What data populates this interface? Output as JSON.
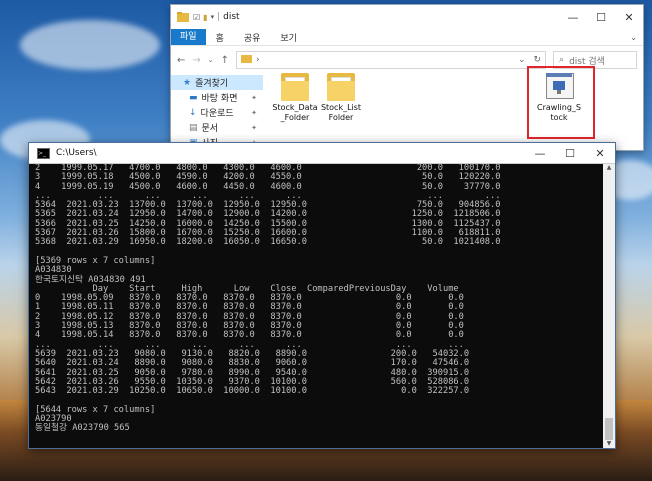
{
  "explorer": {
    "title": "dist",
    "ribbon": {
      "file": "파일",
      "tabs": [
        "홈",
        "공유",
        "보기"
      ]
    },
    "address": "›",
    "search_placeholder": "dist 검색",
    "nav": [
      {
        "label": "즐겨찾기",
        "icon": "star-icon",
        "selected": true,
        "sub": false
      },
      {
        "label": "바탕 화면",
        "icon": "desktop-icon",
        "selected": false,
        "sub": true
      },
      {
        "label": "다운로드",
        "icon": "download-icon",
        "selected": false,
        "sub": true
      },
      {
        "label": "문서",
        "icon": "document-icon",
        "selected": false,
        "sub": true
      },
      {
        "label": "사진",
        "icon": "picture-icon",
        "selected": false,
        "sub": true
      }
    ],
    "items": [
      {
        "name": "Stock_Data\n_Folder",
        "type": "folder"
      },
      {
        "name": "Stock_List\nFolder",
        "type": "folder"
      },
      {
        "name": "Crawling_S\ntock",
        "type": "exe"
      }
    ]
  },
  "console": {
    "title": "C:\\Users\\",
    "lines": [
      "2    1999.05.17   4700.0   4800.0   4300.0   4600.0                      200.0   100170.0",
      "3    1999.05.18   4500.0   4590.0   4200.0   4550.0                       50.0   120220.0",
      "4    1999.05.19   4500.0   4600.0   4450.0   4600.0                       50.0    37770.0",
      "...         ...      ...      ...      ...      ...                        ...        ...",
      "5364  2021.03.23  13700.0  13700.0  12950.0  12950.0                     750.0   904856.0",
      "5365  2021.03.24  12950.0  14700.0  12900.0  14200.0                    1250.0  1218506.0",
      "5366  2021.03.25  14250.0  16000.0  14250.0  15500.0                    1300.0  1125437.0",
      "5367  2021.03.26  15800.0  16700.0  15250.0  16600.0                    1100.0   618811.0",
      "5368  2021.03.29  16950.0  18200.0  16050.0  16650.0                      50.0  1021408.0",
      "",
      "[5369 rows x 7 columns]",
      "A034830",
      "한국토지신탁 A034830 491",
      "           Day    Start     High      Low    Close  ComparedPreviousDay    Volume",
      "0    1998.05.09   8370.0   8370.0   8370.0   8370.0                  0.0       0.0",
      "1    1998.05.11   8370.0   8370.0   8370.0   8370.0                  0.0       0.0",
      "2    1998.05.12   8370.0   8370.0   8370.0   8370.0                  0.0       0.0",
      "3    1998.05.13   8370.0   8370.0   8370.0   8370.0                  0.0       0.0",
      "4    1998.05.14   8370.0   8370.0   8370.0   8370.0                  0.0       0.0",
      "...         ...      ...      ...      ...      ...                  ...       ...",
      "5639  2021.03.23   9080.0   9130.0   8820.0   8890.0                200.0   54032.0",
      "5640  2021.03.24   8890.0   9080.0   8830.0   9060.0                170.0   47546.0",
      "5641  2021.03.25   9050.0   9780.0   8990.0   9540.0                480.0  390915.0",
      "5642  2021.03.26   9550.0  10350.0   9370.0  10100.0                560.0  528086.0",
      "5643  2021.03.29  10250.0  10650.0  10000.0  10100.0                  0.0  322257.0",
      "",
      "[5644 rows x 7 columns]",
      "A023790",
      "동일철강 A023790 565"
    ]
  }
}
